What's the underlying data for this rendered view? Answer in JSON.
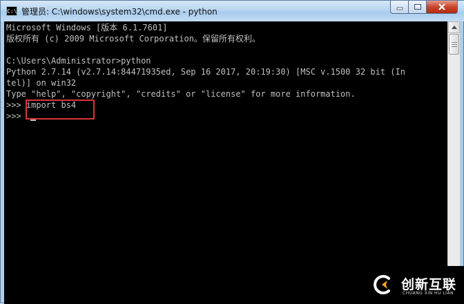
{
  "window": {
    "title": "管理员: C:\\windows\\system32\\cmd.exe - python",
    "icon_text": "C:\\"
  },
  "console": {
    "lines": [
      "Microsoft Windows [版本 6.1.7601]",
      "版权所有 (c) 2009 Microsoft Corporation。保留所有权利。",
      "",
      "C:\\Users\\Administrator>python",
      "Python 2.7.14 (v2.7.14:84471935ed, Sep 16 2017, 20:19:30) [MSC v.1500 32 bit (In",
      "tel)] on win32",
      "Type \"help\", \"copyright\", \"credits\" or \"license\" for more information.",
      ">>> import bs4",
      ">>> "
    ]
  },
  "watermark": {
    "cn": "创新互联",
    "en": "CHUANG XIN HU LIAN"
  },
  "colors": {
    "console_bg": "#000000",
    "console_text": "#c0c0c0",
    "highlight": "#d9363b"
  }
}
